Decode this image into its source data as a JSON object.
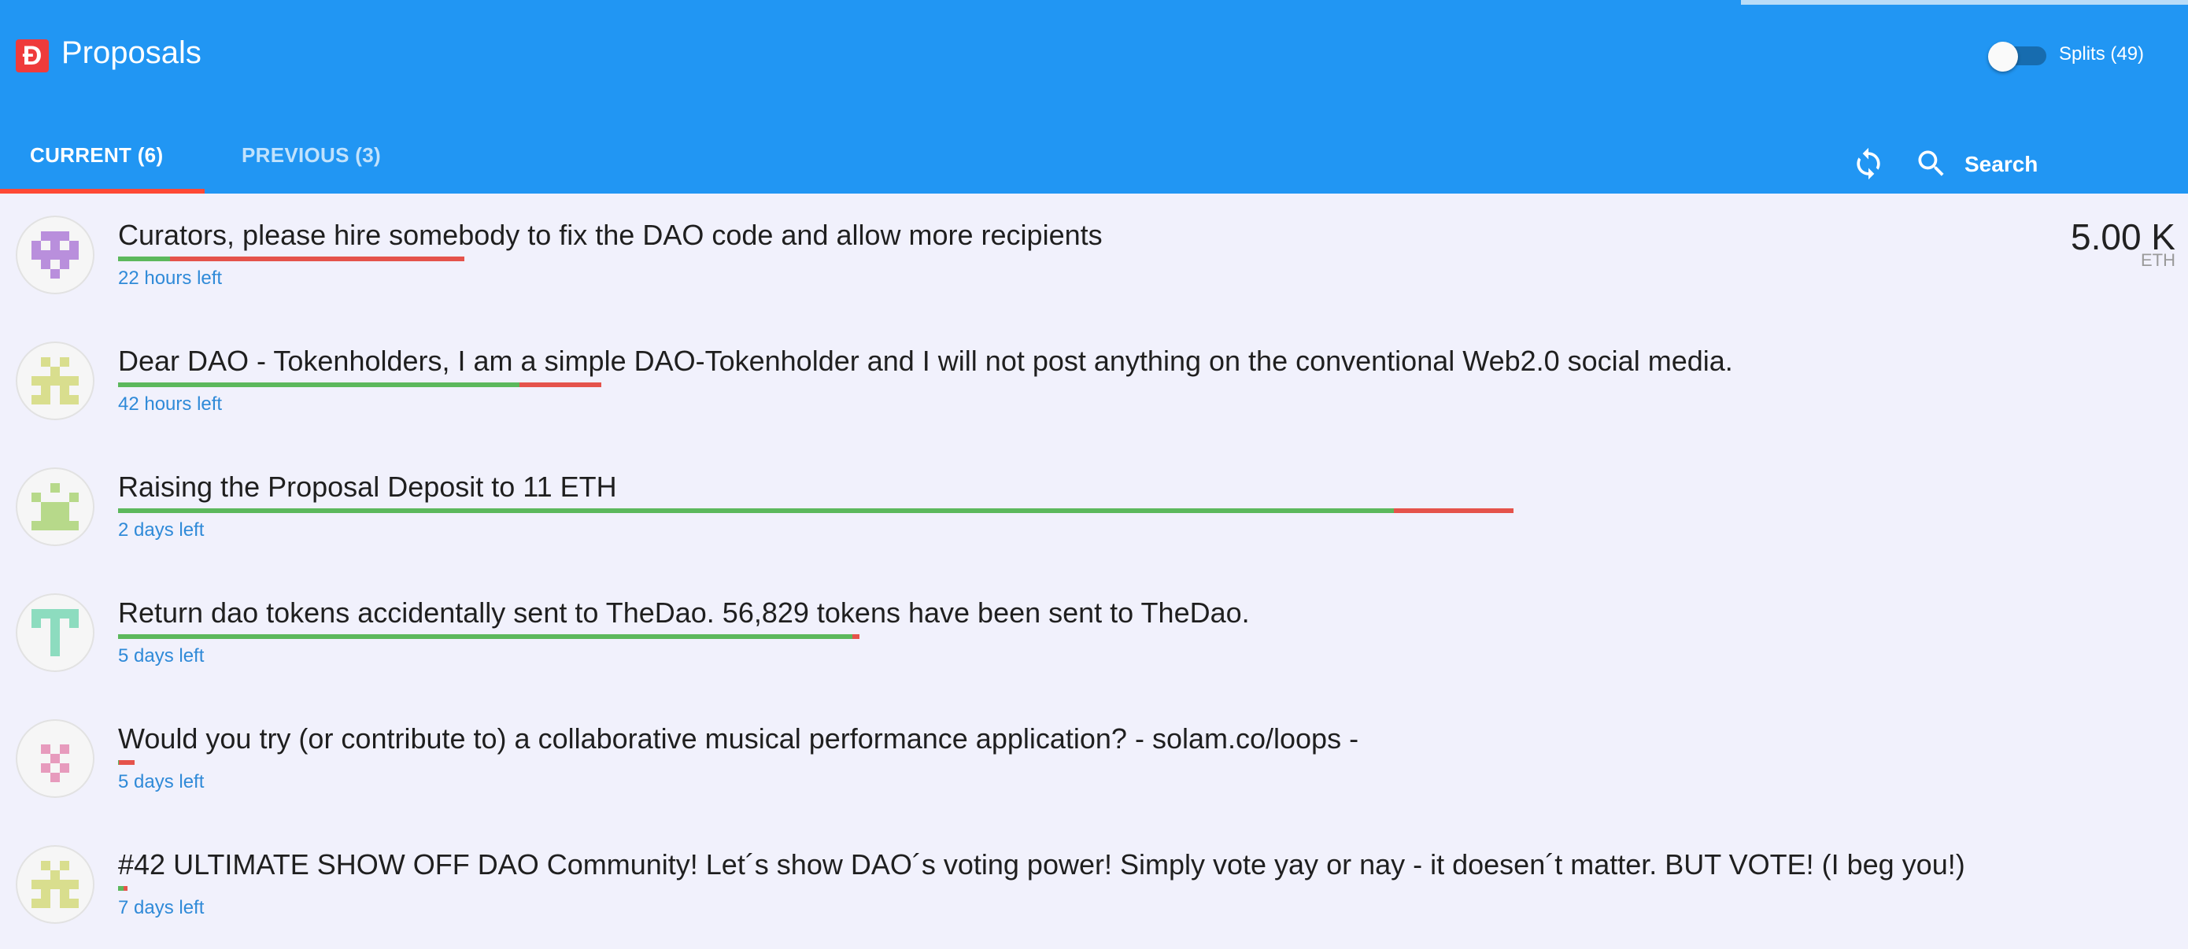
{
  "header": {
    "logo_glyph": "Đ",
    "title": "Proposals",
    "toggle_label": "Splits (49)",
    "toggle_on": false
  },
  "tabs": [
    {
      "label": "CURRENT (6)",
      "active": true
    },
    {
      "label": "PREVIOUS (3)",
      "active": false
    }
  ],
  "toolbar": {
    "refresh_icon": "refresh-icon",
    "search_icon": "search-icon",
    "search_placeholder": "Search"
  },
  "colors": {
    "header": "#2196f3",
    "tab_indicator": "#ff4a35",
    "yes": "#5cb85c",
    "no": "#e5534b",
    "time": "#2f8ad8"
  },
  "proposals": [
    {
      "title": "Curators, please hire somebody to fix the DAO code and allow more recipients",
      "time_left": "22 hours left",
      "amount": "5.00 K",
      "unit": "ETH",
      "votes_total_fraction": 0.185,
      "yes_fraction": 0.15,
      "avatar_color": "#b98fdc"
    },
    {
      "title": "Dear DAO - Tokenholders, I am a simple DAO-Tokenholder and I will not post anything on the conventional Web2.0 social media.",
      "time_left": "42 hours left",
      "amount": "",
      "unit": "",
      "votes_total_fraction": 0.258,
      "yes_fraction": 0.83,
      "avatar_color": "#d9de8e"
    },
    {
      "title": "Raising the Proposal Deposit to 11 ETH",
      "time_left": "2 days left",
      "amount": "",
      "unit": "",
      "votes_total_fraction": 0.745,
      "yes_fraction": 0.914,
      "avatar_color": "#b7d98a"
    },
    {
      "title": "Return dao tokens accidentally sent to TheDao. 56,829 tokens have been sent to TheDao.",
      "time_left": "5 days left",
      "amount": "",
      "unit": "",
      "votes_total_fraction": 0.396,
      "yes_fraction": 0.99,
      "avatar_color": "#8ddcbf"
    },
    {
      "title": "Would you try (or contribute to) a collaborative musical performance application? - solam.co/loops -",
      "time_left": "5 days left",
      "amount": "",
      "unit": "",
      "votes_total_fraction": 0.009,
      "yes_fraction": 0.05,
      "avatar_color": "#e79bbd"
    },
    {
      "title": "#42 ULTIMATE SHOW OFF DAO Community! Let´s show DAO´s voting power! Simply vote yay or nay - it doesen´t matter. BUT VOTE! (I beg you!)",
      "time_left": "7 days left",
      "amount": "",
      "unit": "",
      "votes_total_fraction": 0.005,
      "yes_fraction": 0.6,
      "avatar_color": "#d9de8e"
    }
  ]
}
